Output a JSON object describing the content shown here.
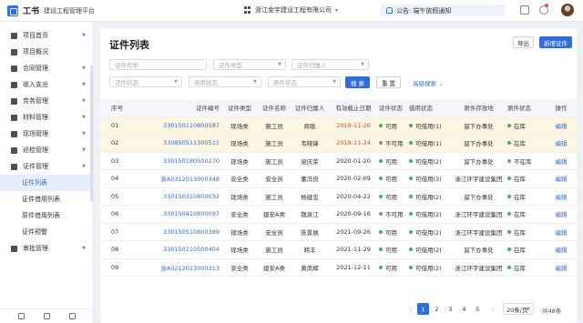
{
  "topbar": {
    "app_name": "工书",
    "app_sub": "建设工程管理平台",
    "company": "浙江金宇建设工程有限公司",
    "notice_prefix": "公告:",
    "notice_text": "端午放假通知"
  },
  "sidebar": {
    "items": [
      {
        "label": "项目首页",
        "icon": "home-icon",
        "arrow": true
      },
      {
        "label": "项目概况",
        "icon": "overview-icon",
        "arrow": false
      },
      {
        "label": "合同管理",
        "icon": "contract-icon",
        "arrow": true
      },
      {
        "label": "收入支出",
        "icon": "money-icon",
        "arrow": true
      },
      {
        "label": "劳务管理",
        "icon": "labor-icon",
        "arrow": true
      },
      {
        "label": "材料管理",
        "icon": "material-icon",
        "arrow": true
      },
      {
        "label": "现场管理",
        "icon": "site-icon",
        "arrow": true
      },
      {
        "label": "巡检管理",
        "icon": "inspect-icon",
        "arrow": true
      },
      {
        "label": "证件管理",
        "icon": "certificate-icon",
        "arrow": true
      }
    ],
    "sub_items": [
      "证件列表",
      "证件借用列表",
      "原件借用列表",
      "证件预警"
    ],
    "last_item": {
      "label": "审批管理",
      "icon": "approval-icon"
    }
  },
  "main": {
    "title": "证件列表",
    "export_label": "导出",
    "new_label": "新增证件",
    "filters": {
      "cert_name": "证件名称",
      "cert_type": "证件类型",
      "cert_owner": "证件归属人",
      "cert_status": "证件状态",
      "borrow_status": "借用状态",
      "original_status": "原件状态",
      "search_label": "搜 索",
      "reset_label": "重 置",
      "advanced_label": "高级搜索"
    },
    "columns": [
      "序号",
      "证件编号",
      "证件类型",
      "证件名称",
      "证件归属人",
      "有效截止日期",
      "证件状态",
      "借用状态",
      "原件存放地",
      "原件状态",
      "操作"
    ],
    "rows": [
      {
        "no": "01",
        "code": "330150110800587",
        "type": "现场类",
        "name": "施工员",
        "owner": "商聪",
        "date": "2019-11-26",
        "date_red": true,
        "cert_status": "可用",
        "cert_color": "#3db55b",
        "borrow": "可借用(1)",
        "borrow_color": "#3db55b",
        "place": "留下办事处",
        "orig": "在库",
        "orig_color": "#3db55b",
        "op": "编辑",
        "hl": true
      },
      {
        "no": "02",
        "code": "330850511300511",
        "type": "现场类",
        "name": "施工员",
        "owner": "韦晓锋",
        "date": "2019-11-24",
        "date_red": true,
        "cert_status": "不可用",
        "cert_color": "#8a8f98",
        "borrow": "可借用(1)",
        "borrow_color": "#3db55b",
        "place": "留下办事处",
        "orig": "在库",
        "orig_color": "#3db55b",
        "op": "编辑",
        "hl": true
      },
      {
        "no": "03",
        "code": "330150180500270",
        "type": "现场类",
        "name": "施工员",
        "owner": "梁庆荣",
        "date": "2020-01-20",
        "date_red": false,
        "cert_status": "可用",
        "cert_color": "#3db55b",
        "borrow": "可借用(2)",
        "borrow_color": "#3db55b",
        "place": "留下办事处",
        "orig": "不在库",
        "orig_color": "#8a8f98",
        "op": "编辑",
        "hl": false
      },
      {
        "no": "04",
        "code": "浙A0312013000348",
        "type": "安全类",
        "name": "安全员",
        "owner": "董冯良",
        "date": "2020-02-09",
        "date_red": false,
        "cert_status": "可用",
        "cert_color": "#3db55b",
        "borrow": "可借用(3)",
        "borrow_color": "#3db55b",
        "place": "浙江环宇建设集团",
        "orig": "在库",
        "orig_color": "#3db55b",
        "op": "编辑",
        "hl": false
      },
      {
        "no": "05",
        "code": "330150310800032",
        "type": "现场类",
        "name": "施工员",
        "owner": "杨健忠",
        "date": "2020-04-22",
        "date_red": false,
        "cert_status": "可用",
        "cert_color": "#3db55b",
        "borrow": "可借用(2)",
        "borrow_color": "#3db55b",
        "place": "留下办事处",
        "orig": "在库",
        "orig_color": "#3db55b",
        "op": "编辑",
        "hl": false
      },
      {
        "no": "06",
        "code": "330150410800097",
        "type": "安全类",
        "name": "建安A类",
        "owner": "魏泉江",
        "date": "2020-09-16",
        "date_red": false,
        "cert_status": "不可用",
        "cert_color": "#8a8f98",
        "borrow": "可借用(2)",
        "borrow_color": "#3db55b",
        "place": "浙江环宇建设集团",
        "orig": "在库",
        "orig_color": "#3db55b",
        "op": "编辑",
        "hl": false
      },
      {
        "no": "07",
        "code": "330150510800389",
        "type": "现场类",
        "name": "安全员",
        "owner": "陈景展",
        "date": "2021-09-26",
        "date_red": false,
        "cert_status": "可用",
        "cert_color": "#3db55b",
        "borrow": "可借用(2)",
        "borrow_color": "#3db55b",
        "place": "浙江环宇建设集团",
        "orig": "在库",
        "orig_color": "#3db55b",
        "op": "编辑",
        "hl": false
      },
      {
        "no": "08",
        "code": "330150110500404",
        "type": "现场类",
        "name": "施工员",
        "owner": "韩丰",
        "date": "2021-11-29",
        "date_red": false,
        "cert_status": "可用",
        "cert_color": "#3db55b",
        "borrow": "可借用(2)",
        "borrow_color": "#3db55b",
        "place": "留下办事处",
        "orig": "在库",
        "orig_color": "#3db55b",
        "op": "编辑",
        "hl": false
      },
      {
        "no": "09",
        "code": "浙A0212013000313",
        "type": "安全类",
        "name": "建安A类",
        "owner": "黄凤辉",
        "date": "2021-12-11",
        "date_red": false,
        "cert_status": "可用",
        "cert_color": "#3db55b",
        "borrow": "可借用(2)",
        "borrow_color": "#3db55b",
        "place": "浙江环宇建设集团",
        "orig": "在库",
        "orig_color": "#3db55b",
        "op": "编辑",
        "hl": false
      }
    ],
    "pagination": {
      "pages": [
        "1",
        "2",
        "3",
        "4",
        "5"
      ],
      "current": "1",
      "page_size": "20条/页",
      "total": "共48条"
    }
  },
  "colors": {
    "accent": "#2f6de1",
    "highlight_row": "#fdf6e2",
    "date_warning": "#e04b3c",
    "status_ok": "#3db55b",
    "status_off": "#8a8f98"
  }
}
